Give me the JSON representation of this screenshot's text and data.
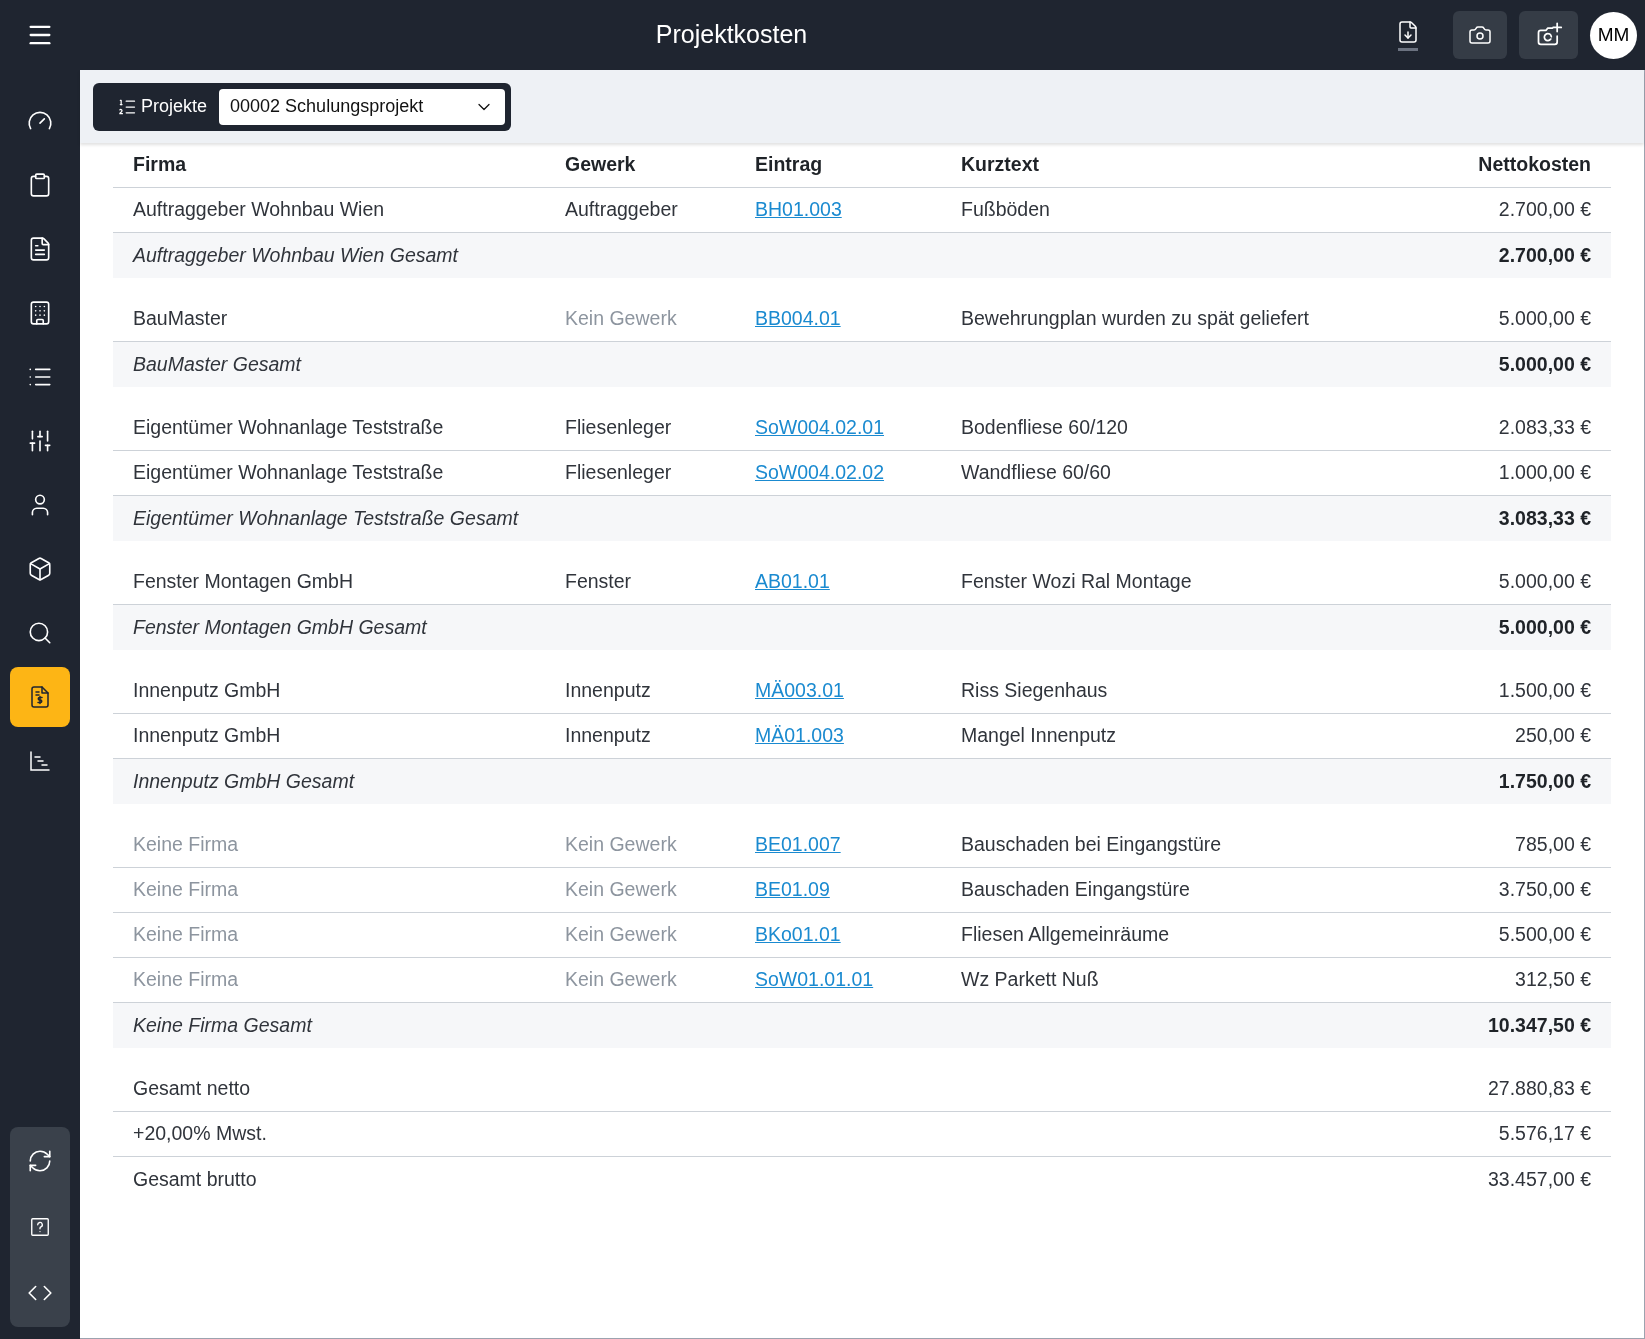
{
  "header": {
    "title": "Projektkosten",
    "avatar": "MM"
  },
  "sidebar": {
    "items": [
      {
        "selected": false
      },
      {
        "selected": false
      },
      {
        "selected": false
      },
      {
        "selected": false
      },
      {
        "selected": false
      },
      {
        "selected": false
      },
      {
        "selected": false
      },
      {
        "selected": false
      },
      {
        "selected": false
      },
      {
        "selected": true
      },
      {
        "selected": false
      }
    ]
  },
  "toolbar": {
    "label": "Projekte",
    "project": "00002 Schulungsprojekt"
  },
  "table": {
    "columns": [
      "Firma",
      "Gewerk",
      "Eintrag",
      "Kurztext",
      "Nettokosten"
    ],
    "groups": [
      {
        "rows": [
          {
            "firma": "Auftraggeber Wohnbau Wien",
            "firma_missing": false,
            "gewerk": "Auftraggeber",
            "gewerk_missing": false,
            "eintrag": "BH01.003",
            "kurztext": "Fußböden",
            "netto": "2.700,00 €"
          }
        ],
        "total_label": "Auftraggeber Wohnbau Wien Gesamt",
        "total": "2.700,00 €"
      },
      {
        "rows": [
          {
            "firma": "BauMaster",
            "firma_missing": false,
            "gewerk": "Kein Gewerk",
            "gewerk_missing": true,
            "eintrag": "BB004.01",
            "kurztext": "Bewehrungplan wurden zu spät geliefert",
            "netto": "5.000,00 €"
          }
        ],
        "total_label": "BauMaster Gesamt",
        "total": "5.000,00 €"
      },
      {
        "rows": [
          {
            "firma": "Eigentümer Wohnanlage Teststraße",
            "firma_missing": false,
            "gewerk": "Fliesenleger",
            "gewerk_missing": false,
            "eintrag": "SoW004.02.01",
            "kurztext": "Bodenfliese 60/120",
            "netto": "2.083,33 €"
          },
          {
            "firma": "Eigentümer Wohnanlage Teststraße",
            "firma_missing": false,
            "gewerk": "Fliesenleger",
            "gewerk_missing": false,
            "eintrag": "SoW004.02.02",
            "kurztext": "Wandfliese 60/60",
            "netto": "1.000,00 €"
          }
        ],
        "total_label": "Eigentümer Wohnanlage Teststraße Gesamt",
        "total": "3.083,33 €"
      },
      {
        "rows": [
          {
            "firma": "Fenster Montagen GmbH",
            "firma_missing": false,
            "gewerk": "Fenster",
            "gewerk_missing": false,
            "eintrag": "AB01.01",
            "kurztext": "Fenster Wozi Ral Montage",
            "netto": "5.000,00 €"
          }
        ],
        "total_label": "Fenster Montagen GmbH Gesamt",
        "total": "5.000,00 €"
      },
      {
        "rows": [
          {
            "firma": "Innenputz GmbH",
            "firma_missing": false,
            "gewerk": "Innenputz",
            "gewerk_missing": false,
            "eintrag": "MÄ003.01",
            "kurztext": "Riss Siegenhaus",
            "netto": "1.500,00 €"
          },
          {
            "firma": "Innenputz GmbH",
            "firma_missing": false,
            "gewerk": "Innenputz",
            "gewerk_missing": false,
            "eintrag": "MÄ01.003",
            "kurztext": "Mangel Innenputz",
            "netto": "250,00 €"
          }
        ],
        "total_label": "Innenputz GmbH Gesamt",
        "total": "1.750,00 €"
      },
      {
        "rows": [
          {
            "firma": "Keine Firma",
            "firma_missing": true,
            "gewerk": "Kein Gewerk",
            "gewerk_missing": true,
            "eintrag": "BE01.007",
            "kurztext": "Bauschaden bei Eingangstüre",
            "netto": "785,00 €"
          },
          {
            "firma": "Keine Firma",
            "firma_missing": true,
            "gewerk": "Kein Gewerk",
            "gewerk_missing": true,
            "eintrag": "BE01.09",
            "kurztext": "Bauschaden Eingangstüre",
            "netto": "3.750,00 €"
          },
          {
            "firma": "Keine Firma",
            "firma_missing": true,
            "gewerk": "Kein Gewerk",
            "gewerk_missing": true,
            "eintrag": "BKo01.01",
            "kurztext": "Fliesen Allgemeinräume",
            "netto": "5.500,00 €"
          },
          {
            "firma": "Keine Firma",
            "firma_missing": true,
            "gewerk": "Kein Gewerk",
            "gewerk_missing": true,
            "eintrag": "SoW01.01.01",
            "kurztext": "Wz Parkett Nuß",
            "netto": "312,50 €"
          }
        ],
        "total_label": "Keine Firma Gesamt",
        "total": "10.347,50 €"
      }
    ],
    "summary": [
      {
        "label": "Gesamt netto",
        "value": "27.880,83 €"
      },
      {
        "label": "+20,00% Mwst.",
        "value": "5.576,17 €"
      },
      {
        "label": "Gesamt brutto",
        "value": "33.457,00 €"
      }
    ]
  }
}
